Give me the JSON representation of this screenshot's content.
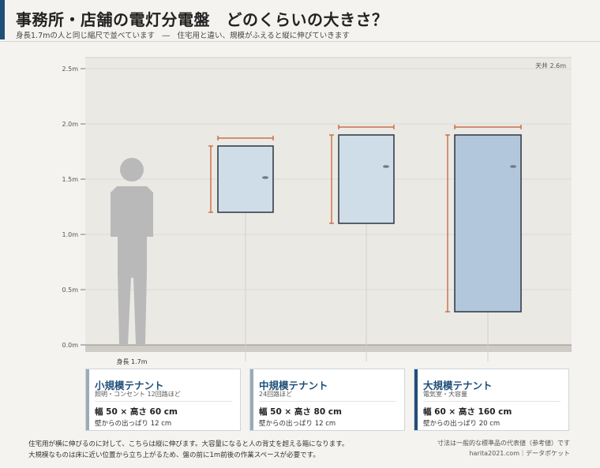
{
  "header": {
    "title": "事務所・店舗の電灯分電盤　どのくらいの大きさ？",
    "subtitle": "身長1.7mの人と同じ縮尺で並べています　―　住宅用と違い、規模がふえると縦に伸びていきます"
  },
  "figure": {
    "y_axis": {
      "min": 0,
      "max": 2.5,
      "step": 0.5,
      "unit": "m",
      "tick_labels": [
        "0.0m",
        "0.5m",
        "1.0m",
        "1.5m",
        "2.0m",
        "2.5m"
      ]
    },
    "ceiling": {
      "height_m": 2.6,
      "label": "天井 2.6m"
    },
    "person": {
      "height_m": 1.7,
      "label": "身長 1.7m"
    },
    "panels": [
      {
        "id": "small",
        "width_cm": 50,
        "height_cm": 60,
        "bottom_m": 1.2,
        "door_color": "#cfdde8"
      },
      {
        "id": "medium",
        "width_cm": 50,
        "height_cm": 80,
        "bottom_m": 1.1,
        "door_color": "#cfdde8"
      },
      {
        "id": "large",
        "width_cm": 60,
        "height_cm": 160,
        "bottom_m": 0.3,
        "door_color": "#b3c7dc"
      }
    ],
    "colors": {
      "dimension": "#c05a2c",
      "panel_border": "#2b3440",
      "person": "#b9b9b9",
      "floor": "#cfccc6"
    }
  },
  "cards": [
    {
      "name": "小規模テナント",
      "desc": "照明・コンセント 12回路ほど",
      "size": "幅 50 × 高さ 60 cm",
      "depth": "壁からの出っぱり 12 cm",
      "stripe_color": "#9aaab8"
    },
    {
      "name": "中規模テナント",
      "desc": "24回路ほど",
      "size": "幅 50 × 高さ 80 cm",
      "depth": "壁からの出っぱり 12 cm",
      "stripe_color": "#9aaab8"
    },
    {
      "name": "大規模テナント",
      "desc": "電気室・大容量",
      "size": "幅 60 × 高さ 160 cm",
      "depth": "壁からの出っぱり 20 cm",
      "stripe_color": "#1f4e79"
    }
  ],
  "footer": {
    "note_line1": "住宅用が横に伸びるのに対して、こちらは縦に伸びます。大容量になると人の背丈を超える箱になります。",
    "note_line2": "大規模なものは床に近い位置から立ち上がるため、盤の前に1m前後の作業スペースが必要です。",
    "credit_line1": "寸法は一般的な標準品の代表値（参考値）です",
    "credit_line2": "harita2021.com｜データポケット"
  }
}
